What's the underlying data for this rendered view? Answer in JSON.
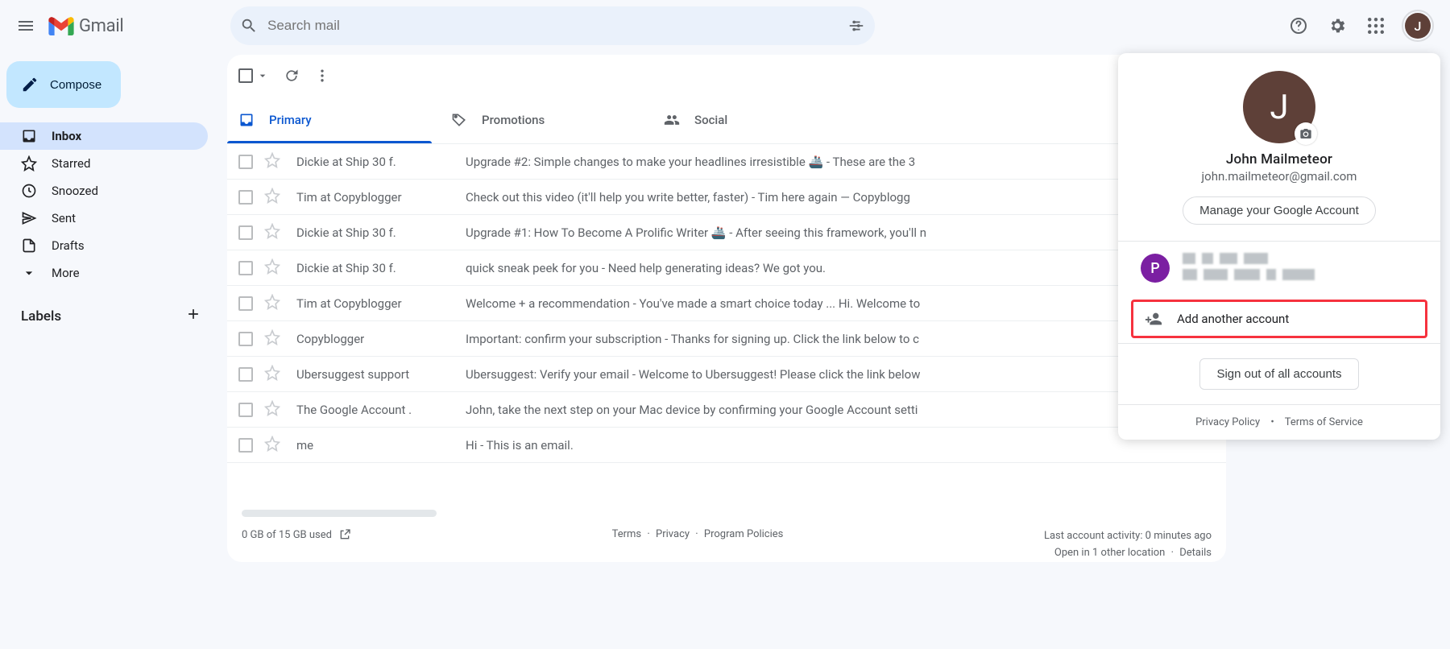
{
  "brand": {
    "name": "Gmail"
  },
  "search": {
    "placeholder": "Search mail"
  },
  "compose": {
    "label": "Compose"
  },
  "nav": {
    "inbox": "Inbox",
    "starred": "Starred",
    "snoozed": "Snoozed",
    "sent": "Sent",
    "drafts": "Drafts",
    "more": "More"
  },
  "labels": {
    "header": "Labels"
  },
  "tabs": {
    "primary": "Primary",
    "promotions": "Promotions",
    "social": "Social"
  },
  "emails": [
    {
      "sender": "Dickie at Ship 30 f.",
      "subject": "Upgrade #2: Simple changes to make your headlines irresistible 🚢",
      "preview": "- These are the 3"
    },
    {
      "sender": "Tim at Copyblogger",
      "subject": "Check out this video (it'll help you write better, faster)",
      "preview": "- Tim here again — Copyblogg"
    },
    {
      "sender": "Dickie at Ship 30 f.",
      "subject": "Upgrade #1: How To Become A Prolific Writer 🚢",
      "preview": "- After seeing this framework, you'll n"
    },
    {
      "sender": "Dickie at Ship 30 f.",
      "subject": "quick sneak peek for you",
      "preview": "- Need help generating ideas? We got you."
    },
    {
      "sender": "Tim at Copyblogger",
      "subject": "Welcome + a recommendation",
      "preview": "- You've made a smart choice today ... Hi. Welcome to"
    },
    {
      "sender": "Copyblogger",
      "subject": "Important: confirm your subscription",
      "preview": "- Thanks for signing up. Click the link below to c"
    },
    {
      "sender": "Ubersuggest support",
      "subject": "Ubersuggest: Verify your email",
      "preview": "- Welcome to Ubersuggest! Please click the link below"
    },
    {
      "sender": "The Google Account .",
      "subject": "John, take the next step on your Mac device by confirming your Google Account setti",
      "preview": ""
    },
    {
      "sender": "me",
      "subject": "Hi",
      "preview": "- This is an email."
    }
  ],
  "footer": {
    "storage": "0 GB of 15 GB used",
    "terms": "Terms",
    "privacy": "Privacy",
    "policies": "Program Policies",
    "activity": "Last account activity: 0 minutes ago",
    "open_in": "Open in 1 other location",
    "details": "Details"
  },
  "account": {
    "initial": "J",
    "name": "John Mailmeteor",
    "email": "john.mailmeteor@gmail.com",
    "manage": "Manage your Google Account",
    "other_initial": "P",
    "add_another": "Add another account",
    "signout": "Sign out of all accounts",
    "privacy": "Privacy Policy",
    "tos": "Terms of Service"
  }
}
